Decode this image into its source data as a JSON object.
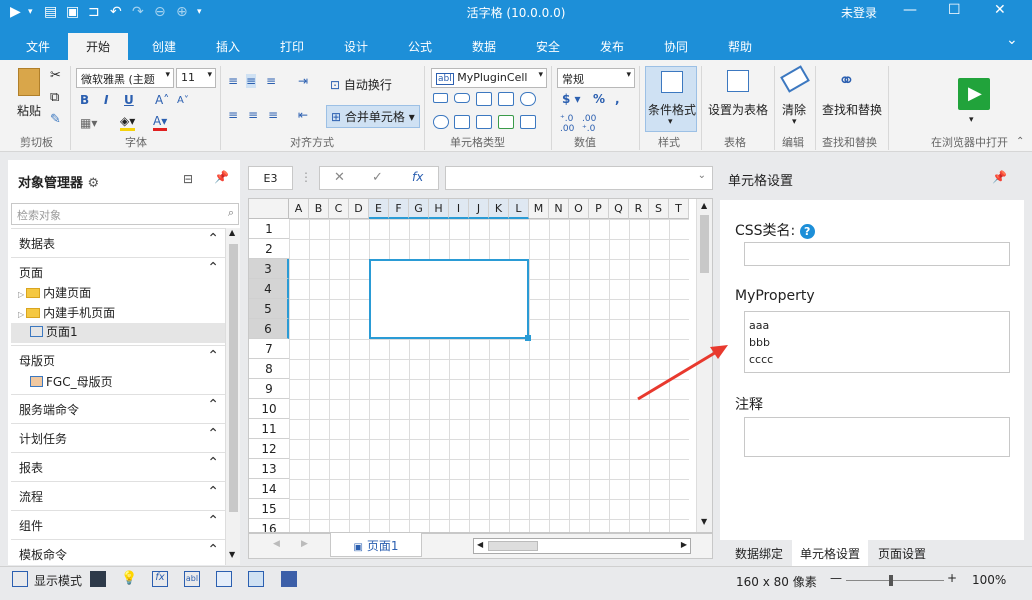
{
  "app": {
    "title": "活字格 (10.0.0.0)",
    "login": "未登录"
  },
  "tabs": [
    {
      "label": "文件"
    },
    {
      "label": "开始"
    },
    {
      "label": "创建"
    },
    {
      "label": "插入"
    },
    {
      "label": "打印"
    },
    {
      "label": "设计"
    },
    {
      "label": "公式"
    },
    {
      "label": "数据"
    },
    {
      "label": "安全"
    },
    {
      "label": "发布"
    },
    {
      "label": "协同"
    },
    {
      "label": "帮助"
    }
  ],
  "ribbon": {
    "paste": "粘贴",
    "font_name": "微软雅黑 (主题",
    "font_size": "11",
    "wrap_text": "自动换行",
    "merge_cells": "合并单元格",
    "cell_type": "MyPluginCell",
    "number_format": "常规",
    "conditional_format": "条件格式",
    "set_as_table": "设置为表格",
    "clear": "清除",
    "find_replace": "查找和替换",
    "open_browser": "在浏览器中打开",
    "groups": {
      "clipboard": "剪切板",
      "font": "字体",
      "align": "对齐方式",
      "celltype": "单元格类型",
      "number": "数值",
      "style": "样式",
      "table": "表格",
      "edit": "编辑",
      "find": "查找和替换"
    }
  },
  "left_panel": {
    "title": "对象管理器",
    "search_placeholder": "检索对象",
    "sections": [
      {
        "label": "数据表"
      },
      {
        "label": "页面"
      },
      {
        "label": "母版页"
      },
      {
        "label": "服务端命令"
      },
      {
        "label": "计划任务"
      },
      {
        "label": "报表"
      },
      {
        "label": "流程"
      },
      {
        "label": "组件"
      },
      {
        "label": "模板命令"
      }
    ],
    "page_items": [
      {
        "label": "内建页面"
      },
      {
        "label": "内建手机页面"
      },
      {
        "label": "页面1"
      }
    ],
    "master_item": "FGC_母版页"
  },
  "formula_bar": {
    "cell_ref": "E3",
    "fx": "fx"
  },
  "grid": {
    "columns": [
      "A",
      "B",
      "C",
      "D",
      "E",
      "F",
      "G",
      "H",
      "I",
      "J",
      "K",
      "L",
      "M",
      "N",
      "O",
      "P",
      "Q",
      "R",
      "S",
      "T"
    ],
    "rows": [
      "1",
      "2",
      "3",
      "4",
      "5",
      "6",
      "7",
      "8",
      "9",
      "10",
      "11",
      "12",
      "13",
      "14",
      "15",
      "16"
    ]
  },
  "sheet_tab": "页面1",
  "right_panel": {
    "title": "单元格设置",
    "css_label": "CSS类名:",
    "my_property_label": "MyProperty",
    "my_property_lines": [
      "aaa",
      "bbb",
      "cccc"
    ],
    "comment_label": "注释",
    "tabs": [
      {
        "label": "数据绑定"
      },
      {
        "label": "单元格设置"
      },
      {
        "label": "页面设置"
      }
    ]
  },
  "status": {
    "display_mode": "显示模式",
    "size": "160 x 80 像素",
    "zoom": "100%"
  },
  "colors": {
    "accent": "#1d8fd8",
    "selection": "#2a9bd5",
    "arrow": "#e8392e"
  }
}
